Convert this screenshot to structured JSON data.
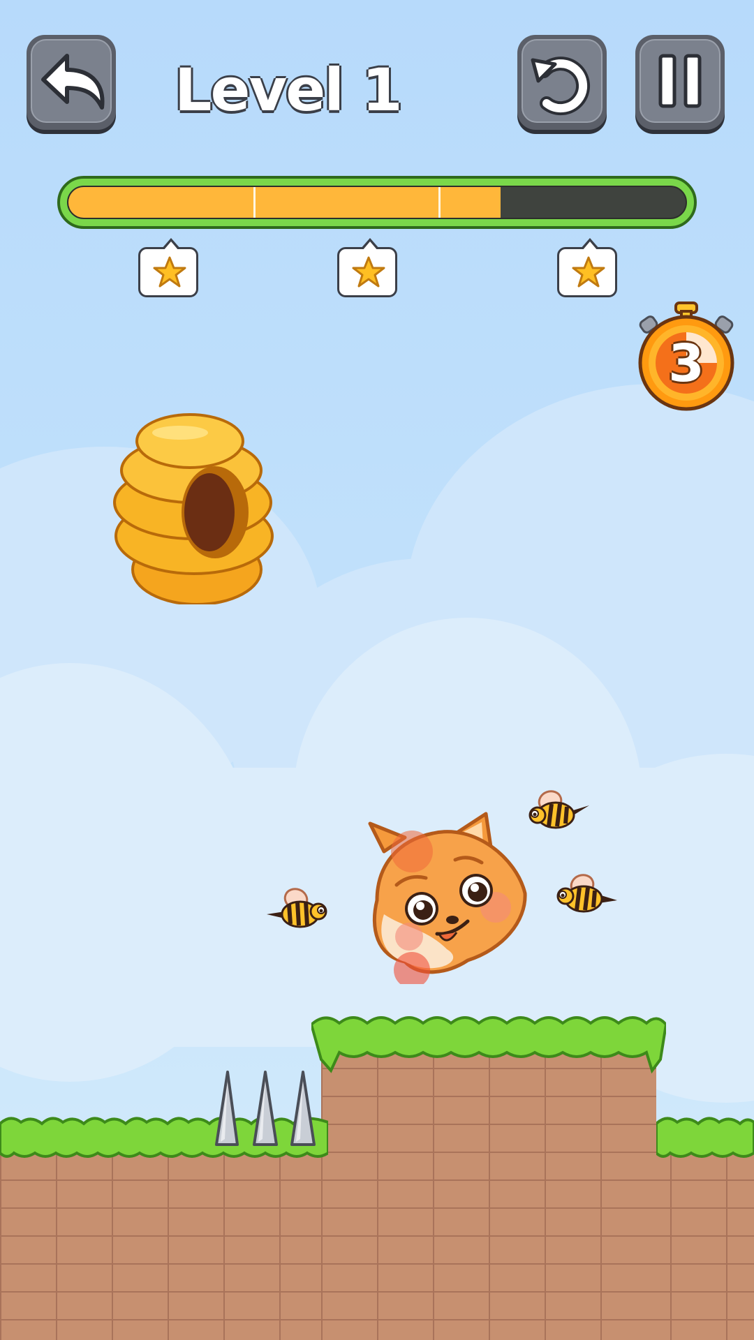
{
  "hud": {
    "back_icon": "undo-arrow-icon",
    "level_title": "Level 1",
    "restart_icon": "restart-icon",
    "pause_icon": "pause-icon"
  },
  "progress": {
    "fill_fraction": 0.7,
    "star_thresholds": [
      0.3,
      0.6,
      0.92
    ],
    "stars": [
      "star-icon",
      "star-icon",
      "star-icon"
    ]
  },
  "timer": {
    "value": "3",
    "icon": "stopwatch-icon"
  },
  "colors": {
    "sky": "#b9dcfb",
    "grass": "#7ed63a",
    "brick": "#c89070",
    "button": "#7b818d",
    "progress_fill": "#ffb73a",
    "honey": "#f6a623"
  },
  "scene": {
    "characters": [
      "shiba-dog",
      "bee",
      "bee",
      "bee"
    ],
    "objects": [
      "beehive",
      "metal-spikes",
      "brick-wall",
      "grass"
    ]
  }
}
